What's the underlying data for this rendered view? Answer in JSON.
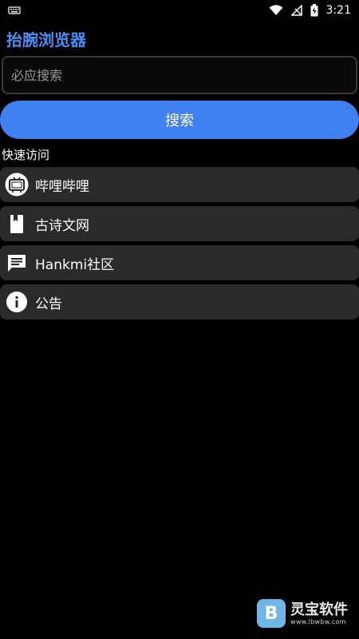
{
  "status_bar": {
    "time": "3:21",
    "icons": [
      "keyboard-icon",
      "wifi-icon",
      "no-signal-icon",
      "battery-charging-icon"
    ]
  },
  "app": {
    "title": "抬腕浏览器"
  },
  "search": {
    "placeholder": "必应搜索",
    "value": "",
    "button_label": "搜索"
  },
  "quick_access": {
    "title": "快速访问",
    "items": [
      {
        "label": "哔哩哔哩",
        "icon": "bilibili-tv-icon"
      },
      {
        "label": "古诗文网",
        "icon": "book-icon"
      },
      {
        "label": "Hankmi社区",
        "icon": "chat-icon"
      },
      {
        "label": "公告",
        "icon": "info-icon"
      }
    ]
  },
  "watermark": {
    "name": "灵宝软件",
    "url": "www.lbwbw.com"
  },
  "colors": {
    "accent": "#3f80f0",
    "title": "#4a8df3",
    "item_bg": "#2a2a2a",
    "background": "#000000"
  }
}
